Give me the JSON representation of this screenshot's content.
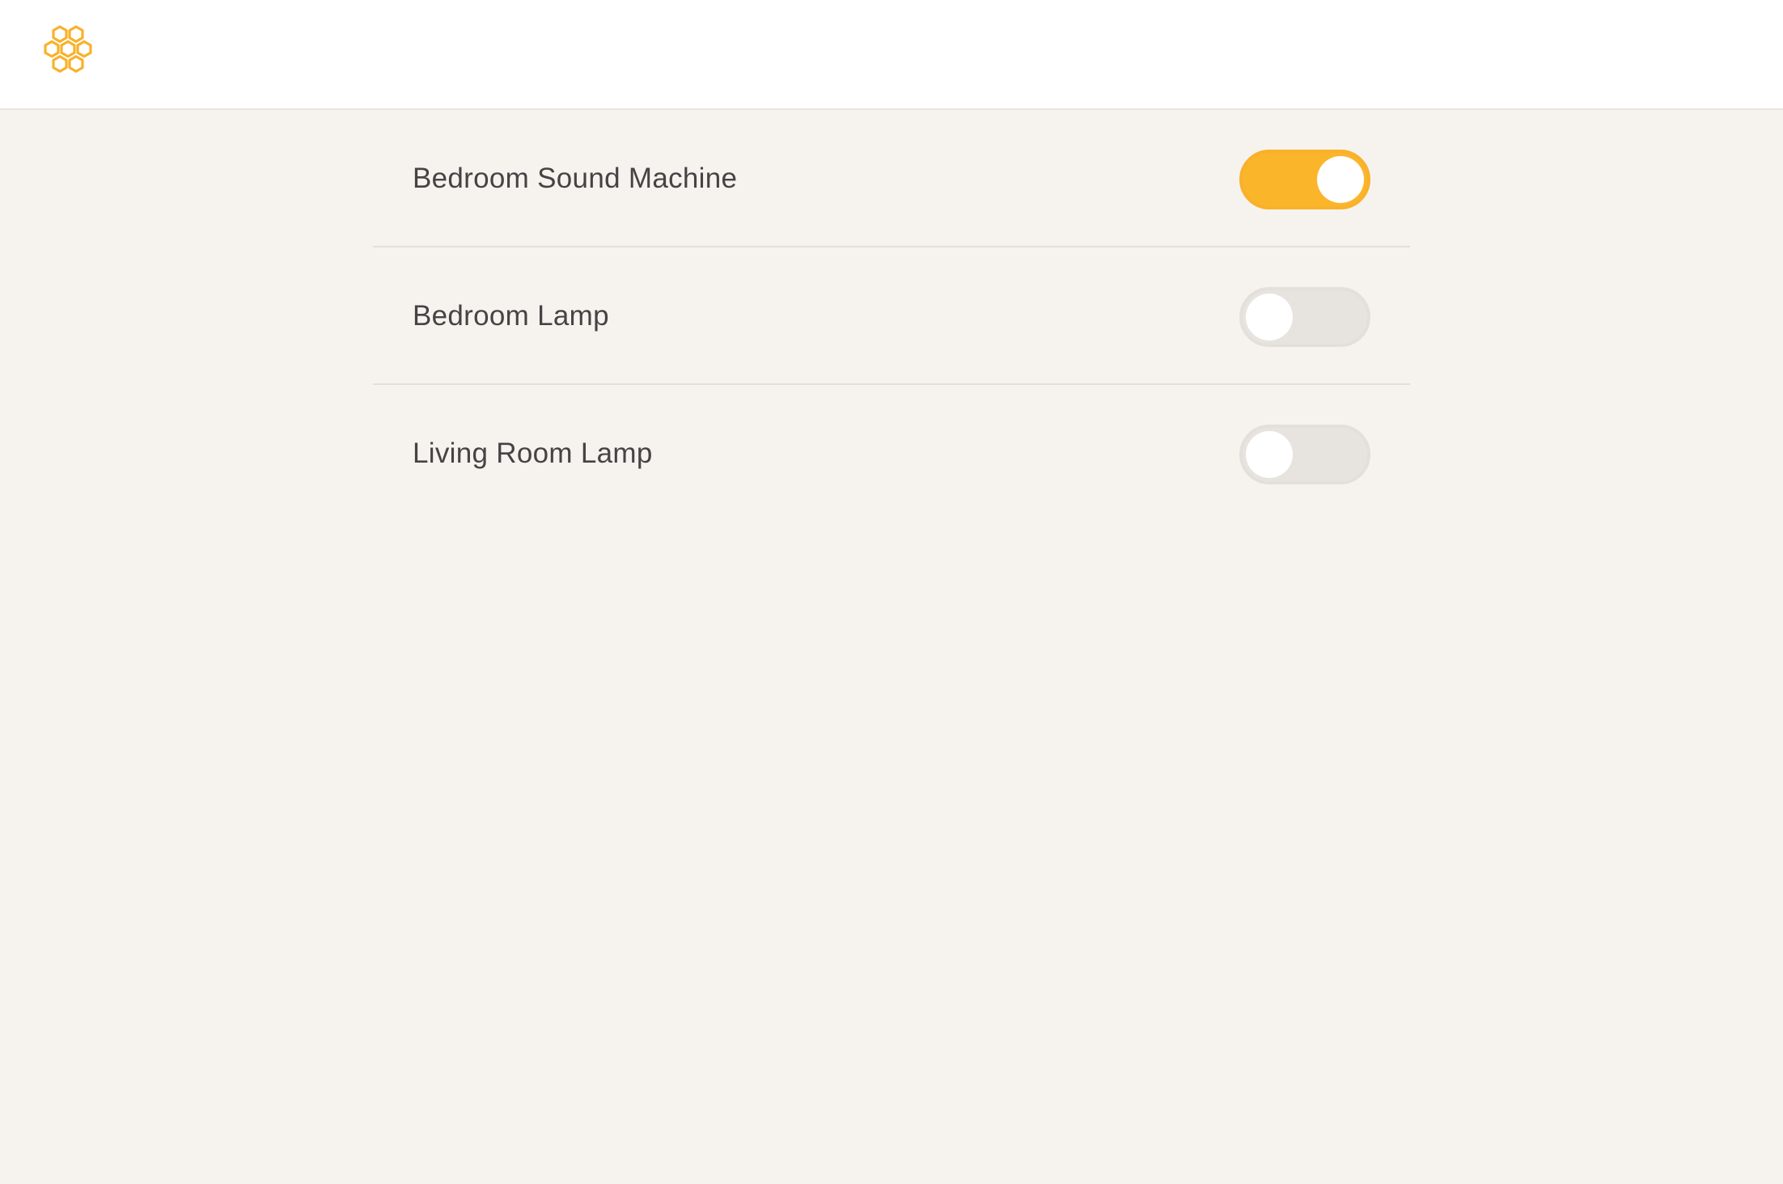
{
  "brand": {
    "logo_icon": "honeycomb-icon",
    "accent_color": "#fbb52b"
  },
  "devices": [
    {
      "label": "Bedroom Sound Machine",
      "state": "on"
    },
    {
      "label": "Bedroom Lamp",
      "state": "off"
    },
    {
      "label": "Living Room Lamp",
      "state": "off"
    }
  ],
  "colors": {
    "toggle_on": "#fbb52b",
    "toggle_off": "#e7e4e0",
    "background": "#f6f3ef",
    "text": "#444444"
  }
}
